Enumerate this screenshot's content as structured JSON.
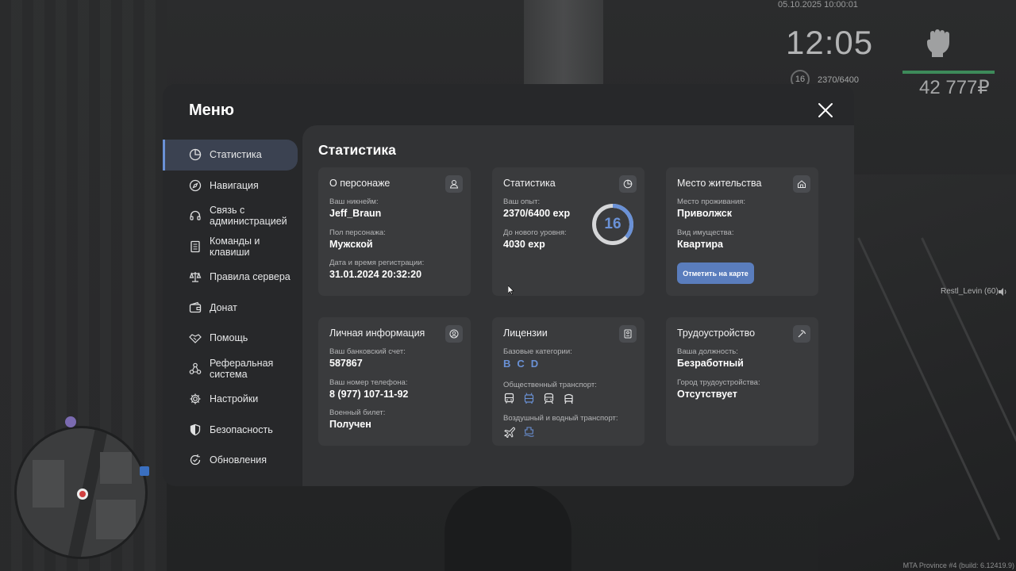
{
  "hud": {
    "datetime": "05.10.2025 10:00:01",
    "time": "12:05",
    "level": "16",
    "exp": "2370/6400",
    "money": "42 777₽",
    "player_tag": "Restl_Levin (60)",
    "build": "MTA Province #4 (build: 6.12419.9)"
  },
  "menu": {
    "title": "Меню",
    "sidebar": [
      {
        "label": "Статистика",
        "icon": "pie-chart-icon",
        "active": true
      },
      {
        "label": "Навигация",
        "icon": "compass-icon"
      },
      {
        "label": "Связь с администрацией",
        "icon": "headset-icon"
      },
      {
        "label": "Команды и клавиши",
        "icon": "document-icon"
      },
      {
        "label": "Правила сервера",
        "icon": "scales-icon"
      },
      {
        "label": "Донат",
        "icon": "wallet-icon"
      },
      {
        "label": "Помощь",
        "icon": "handshake-icon"
      },
      {
        "label": "Реферальная система",
        "icon": "network-icon"
      },
      {
        "label": "Настройки",
        "icon": "gear-icon"
      },
      {
        "label": "Безопасность",
        "icon": "shield-icon"
      },
      {
        "label": "Обновления",
        "icon": "refresh-icon"
      }
    ]
  },
  "content": {
    "title": "Статистика",
    "character": {
      "title": "О персонаже",
      "nickname_label": "Ваш никнейм:",
      "nickname": "Jeff_Braun",
      "gender_label": "Пол персонажа:",
      "gender": "Мужской",
      "reg_label": "Дата и время регистрации:",
      "reg_date": "31.01.2024 20:32:20"
    },
    "stats": {
      "title": "Статистика",
      "exp_label": "Ваш опыт:",
      "exp_value": "2370/6400 exp",
      "next_label": "До нового уровня:",
      "next_value": "4030 exp",
      "level": "16",
      "progress": 0.37
    },
    "residence": {
      "title": "Место жительства",
      "place_label": "Место проживания:",
      "place": "Приволжск",
      "type_label": "Вид имущества:",
      "type": "Квартира",
      "map_button": "Отметить на карте"
    },
    "personal": {
      "title": "Личная информация",
      "account_label": "Ваш банковский счет:",
      "account": "587867",
      "phone_label": "Ваш номер телефона:",
      "phone": "8 (977) 107-11-92",
      "military_label": "Военный билет:",
      "military": "Получен"
    },
    "licenses": {
      "title": "Лицензии",
      "basic_label": "Базовые категории:",
      "categories": [
        "B",
        "C",
        "D"
      ],
      "public_label": "Общественный транспорт:",
      "air_label": "Воздушный и водный транспорт:"
    },
    "employment": {
      "title": "Трудоустройство",
      "position_label": "Ваша должность:",
      "position": "Безработный",
      "city_label": "Город трудоустройства:",
      "city": "Отсутствует"
    }
  },
  "colors": {
    "accent": "#6a91d6",
    "button": "#5a7dbd",
    "money_bar": "#3d8a5a"
  }
}
